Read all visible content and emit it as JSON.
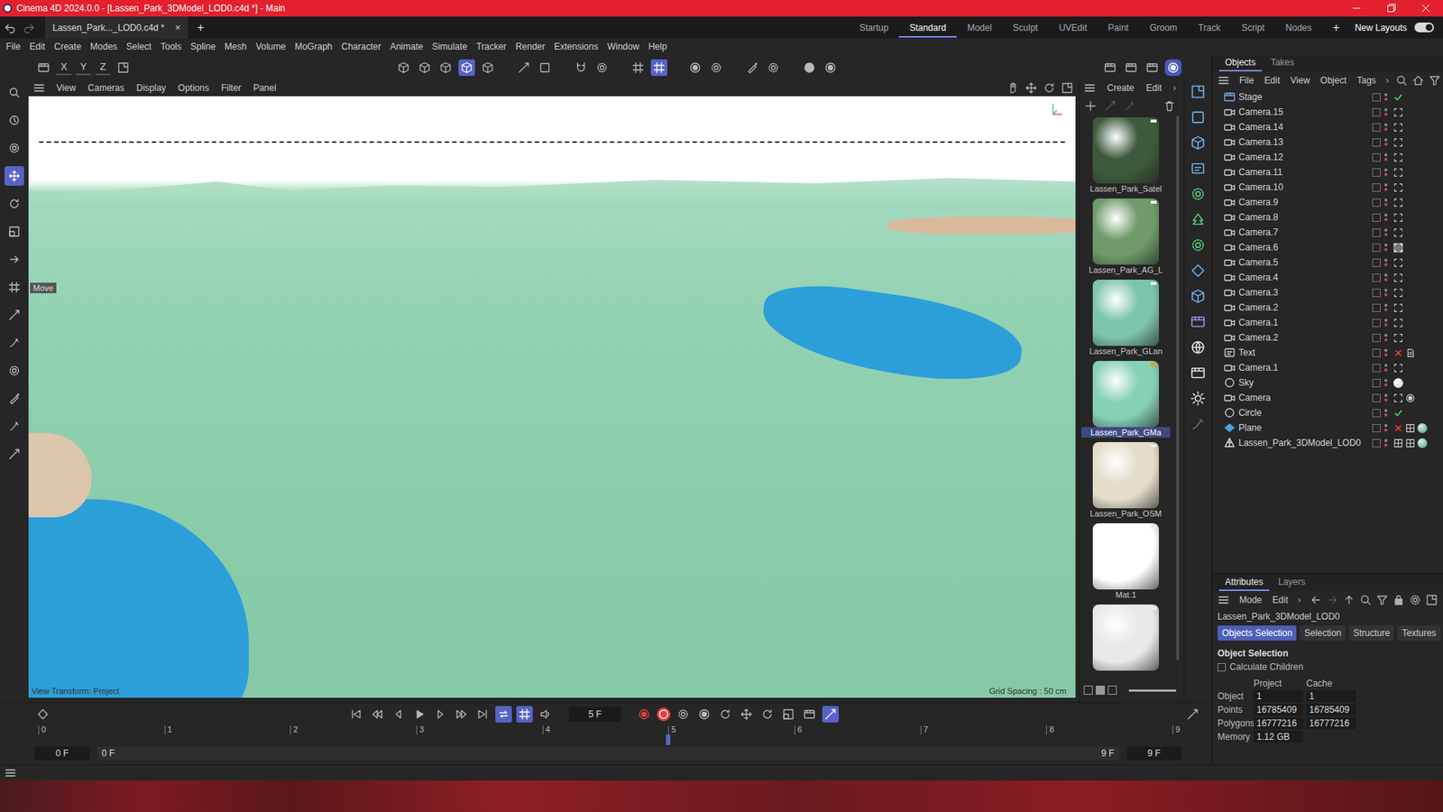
{
  "window": {
    "title": "Cinema 4D 2024.0.0 - [Lassen_Park_3DModel_LOD0.c4d *] - Main"
  },
  "document_tabs": [
    {
      "label": "Lassen_Park..._LOD0.c4d *",
      "selected": true,
      "close": "×"
    }
  ],
  "new_tab": "+",
  "layouts": [
    {
      "label": "Startup",
      "selected": false
    },
    {
      "label": "Standard",
      "selected": true
    },
    {
      "label": "Model",
      "selected": false
    },
    {
      "label": "Sculpt",
      "selected": false
    },
    {
      "label": "UVEdit",
      "selected": false
    },
    {
      "label": "Paint",
      "selected": false
    },
    {
      "label": "Groom",
      "selected": false
    },
    {
      "label": "Track",
      "selected": false
    },
    {
      "label": "Script",
      "selected": false
    },
    {
      "label": "Nodes",
      "selected": false
    }
  ],
  "add_layout": "+",
  "new_layouts": {
    "label": "New Layouts",
    "on": true
  },
  "menu": [
    "File",
    "Edit",
    "Create",
    "Modes",
    "Select",
    "Tools",
    "Spline",
    "Mesh",
    "Volume",
    "MoGraph",
    "Character",
    "Animate",
    "Simulate",
    "Tracker",
    "Render",
    "Extensions",
    "Window",
    "Help"
  ],
  "axis_buttons": [
    "X",
    "Y",
    "Z"
  ],
  "toolbar_toggles": [
    {
      "on": false
    },
    {
      "on": false
    },
    {
      "on": false
    },
    {
      "on": true
    },
    {
      "on": false
    },
    {
      "on": false
    },
    {
      "on": false
    },
    {
      "on": false
    },
    {
      "on": false
    },
    {
      "on": false
    },
    {
      "on": true
    },
    {
      "on": false
    },
    {
      "on": false
    },
    {
      "on": false
    },
    {
      "on": false
    },
    {
      "on": false
    },
    {
      "on": false
    }
  ],
  "left_tools": [
    {
      "selected": false
    },
    {
      "selected": false
    },
    {
      "selected": false
    },
    {
      "selected": true
    },
    {
      "selected": false
    },
    {
      "selected": false
    },
    {
      "selected": false
    },
    {
      "selected": false
    },
    {
      "selected": false
    },
    {
      "selected": false
    },
    {
      "selected": false
    },
    {
      "selected": false
    },
    {
      "selected": false
    },
    {
      "selected": false
    }
  ],
  "viewport": {
    "menu": [
      "View",
      "Cameras",
      "Display",
      "Options",
      "Filter",
      "Panel"
    ],
    "tool_label": "Move",
    "view_transform": "View Transform: Project",
    "grid_spacing": "Grid Spacing : 50 cm"
  },
  "materials": {
    "menu": [
      "Create",
      "Edit"
    ],
    "more": "›",
    "items": [
      {
        "name": "Lassen_Park_Satel",
        "selected": false,
        "color": "#3e5a3c"
      },
      {
        "name": "Lassen_Park_AG_L",
        "selected": false,
        "color": "#6f9a6a"
      },
      {
        "name": "Lassen_Park_GLan",
        "selected": false,
        "color": "#7cc4ad"
      },
      {
        "name": "Lassen_Park_GMa",
        "selected": true,
        "color": "#86d1b4"
      },
      {
        "name": "Lassen_Park_OSM",
        "selected": false,
        "color": "#e3ddc9"
      },
      {
        "name": "Mat.1",
        "selected": false,
        "color": "#ffffff"
      },
      {
        "selected": false,
        "color": "#e8e8e8"
      }
    ]
  },
  "objects": {
    "tabs": [
      {
        "label": "Objects",
        "selected": true
      },
      {
        "label": "Takes",
        "selected": false
      }
    ],
    "menu": [
      "File",
      "Edit",
      "View",
      "Object",
      "Tags"
    ],
    "more": "›",
    "items": [
      {
        "name": "Stage",
        "kind": "stage",
        "tags": [
          "check"
        ],
        "active": false
      },
      {
        "name": "Camera.15",
        "kind": "camera",
        "tags": [
          "target"
        ],
        "active": false
      },
      {
        "name": "Camera.14",
        "kind": "camera",
        "tags": [
          "target"
        ],
        "active": false
      },
      {
        "name": "Camera.13",
        "kind": "camera",
        "tags": [
          "target"
        ],
        "active": false
      },
      {
        "name": "Camera.12",
        "kind": "camera",
        "tags": [
          "target"
        ],
        "active": false
      },
      {
        "name": "Camera.11",
        "kind": "camera",
        "tags": [
          "target"
        ],
        "active": false
      },
      {
        "name": "Camera.10",
        "kind": "camera",
        "tags": [
          "target"
        ],
        "active": false
      },
      {
        "name": "Camera.9",
        "kind": "camera",
        "tags": [
          "target"
        ],
        "active": false
      },
      {
        "name": "Camera.8",
        "kind": "camera",
        "tags": [
          "target"
        ],
        "active": false
      },
      {
        "name": "Camera.7",
        "kind": "camera",
        "tags": [
          "target"
        ],
        "active": false
      },
      {
        "name": "Camera.6",
        "kind": "camera",
        "tags": [
          "target"
        ],
        "active": true
      },
      {
        "name": "Camera.5",
        "kind": "camera",
        "tags": [
          "target"
        ],
        "active": false
      },
      {
        "name": "Camera.4",
        "kind": "camera",
        "tags": [
          "target"
        ],
        "active": false
      },
      {
        "name": "Camera.3",
        "kind": "camera",
        "tags": [
          "target"
        ],
        "active": false
      },
      {
        "name": "Camera.2",
        "kind": "camera",
        "tags": [
          "target"
        ],
        "active": false
      },
      {
        "name": "Camera.1",
        "kind": "camera",
        "tags": [
          "target"
        ],
        "active": false
      },
      {
        "name": "Camera.2",
        "kind": "camera",
        "tags": [
          "target"
        ],
        "active": false
      },
      {
        "name": "Text",
        "kind": "text",
        "tags": [
          "cross",
          "text-tag"
        ],
        "active": false
      },
      {
        "name": "Camera.1",
        "kind": "camera",
        "tags": [
          "target"
        ],
        "active": false
      },
      {
        "name": "Sky",
        "kind": "sky",
        "tags": [
          "sky-material"
        ],
        "active": false
      },
      {
        "name": "Camera",
        "kind": "camera",
        "tags": [
          "target",
          "align"
        ],
        "active": false
      },
      {
        "name": "Circle",
        "kind": "circle",
        "tags": [
          "check"
        ],
        "active": false
      },
      {
        "name": "Plane",
        "kind": "plane",
        "tags": [
          "cross",
          "texture",
          "material"
        ],
        "active": false
      },
      {
        "name": "Lassen_Park_3DModel_LOD0",
        "kind": "mesh",
        "tags": [
          "texture",
          "texture",
          "material"
        ],
        "active": false
      }
    ]
  },
  "attributes": {
    "tabs": [
      {
        "label": "Attributes",
        "selected": true
      },
      {
        "label": "Layers",
        "selected": false
      }
    ],
    "menu": [
      "Mode",
      "Edit"
    ],
    "more": "›",
    "object_name": "Lassen_Park_3DModel_LOD0",
    "subtabs": [
      {
        "label": "Objects Selection",
        "selected": true
      },
      {
        "label": "Selection",
        "selected": false
      },
      {
        "label": "Structure",
        "selected": false
      },
      {
        "label": "Textures",
        "selected": false
      }
    ],
    "section": "Object Selection",
    "calculate_children": {
      "label": "Calculate Children",
      "checked": false
    },
    "columns": [
      "Project",
      "Cache"
    ],
    "rows": [
      {
        "label": "Object",
        "project": "1",
        "cache": "1"
      },
      {
        "label": "Points",
        "project": "16785409",
        "cache": "16785409"
      },
      {
        "label": "Polygons",
        "project": "16777216",
        "cache": "16777216"
      },
      {
        "label": "Memory",
        "project": "1.12 GB"
      }
    ]
  },
  "timeline": {
    "frame": "5 F",
    "ticks": [
      "0",
      "1",
      "2",
      "3",
      "4",
      "5",
      "6",
      "7",
      "8",
      "9"
    ],
    "current": 5,
    "start": "0 F",
    "range_start": "0 F",
    "range_end": "9 F",
    "end": "9 F"
  }
}
